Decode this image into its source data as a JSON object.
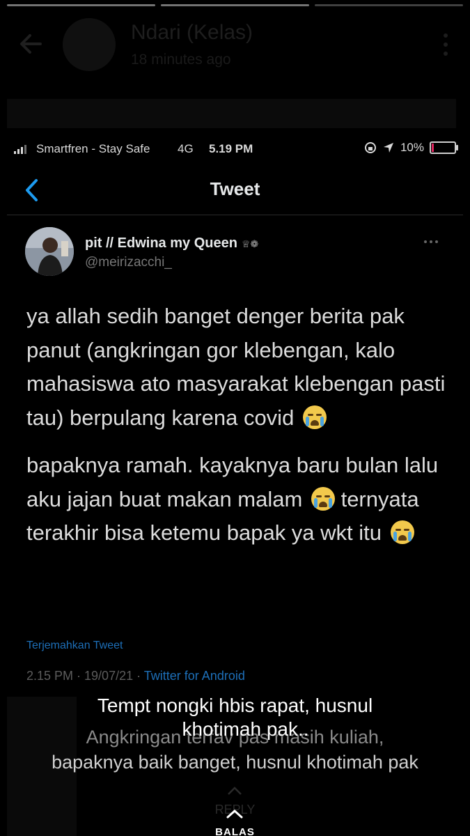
{
  "story": {
    "sender_name": "Ndari (Kelas)",
    "time_ago": "18 minutes ago"
  },
  "status_bar": {
    "carrier": "Smartfren - Stay Safe",
    "network": "4G",
    "time": "5.19 PM",
    "battery_percent": "10%",
    "battery_level": 0.1
  },
  "twitter": {
    "nav_title": "Tweet",
    "author": {
      "name": "pit // Edwina my Queen",
      "handle": "@meirizacchi_"
    },
    "body": {
      "p1": "ya allah sedih banget denger berita pak panut (angkringan gor klebengan, kalo mahasiswa ato masyarakat klebengan pasti tau) berpulang karena covid",
      "p2": "bapaknya ramah. kayaknya baru bulan lalu aku jajan buat makan malam",
      "p3": "ternyata terakhir bisa ketemu bapak ya wkt itu"
    },
    "translate_label": "Terjemahkan Tweet",
    "meta": {
      "time_date": "2.15 PM · 19/07/21 ·",
      "source": "Twitter for Android"
    }
  },
  "caption": {
    "line1": "Tempt nongki hbis rapat, husnul",
    "line2": "khotimah pak.."
  },
  "reply_overlay": {
    "line1": "Angkringan terfav pas masih kuliah,",
    "line2": "bapaknya baik banget, husnul khotimah pak",
    "reply_label": "REPLY",
    "balas_label": "BALAS"
  },
  "icons": {
    "back": "arrow-left-icon",
    "menu": "kebab-menu-icon",
    "twitter_back": "chevron-left-icon",
    "emoji": "loudly-crying-face-icon",
    "location": "location-arrow-icon",
    "rotation_lock": "rotation-lock-icon"
  }
}
